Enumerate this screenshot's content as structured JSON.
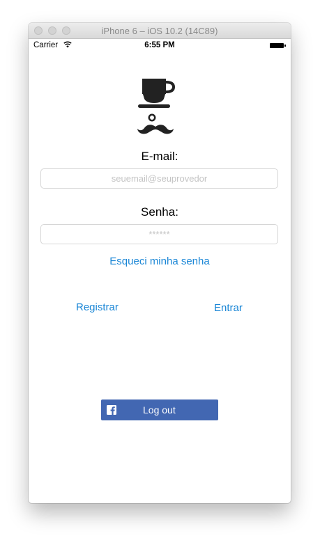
{
  "window": {
    "title": "iPhone 6 – iOS 10.2 (14C89)"
  },
  "status_bar": {
    "carrier": "Carrier",
    "time": "6:55 PM"
  },
  "form": {
    "email_label": "E-mail:",
    "email_placeholder": "seuemail@seuprovedor",
    "password_label": "Senha:",
    "password_placeholder": "******",
    "forgot_link": "Esqueci minha senha"
  },
  "actions": {
    "register": "Registrar",
    "login": "Entrar"
  },
  "facebook": {
    "label": "Log out",
    "color": "#4267b2"
  },
  "colors": {
    "link": "#1a86d6"
  }
}
